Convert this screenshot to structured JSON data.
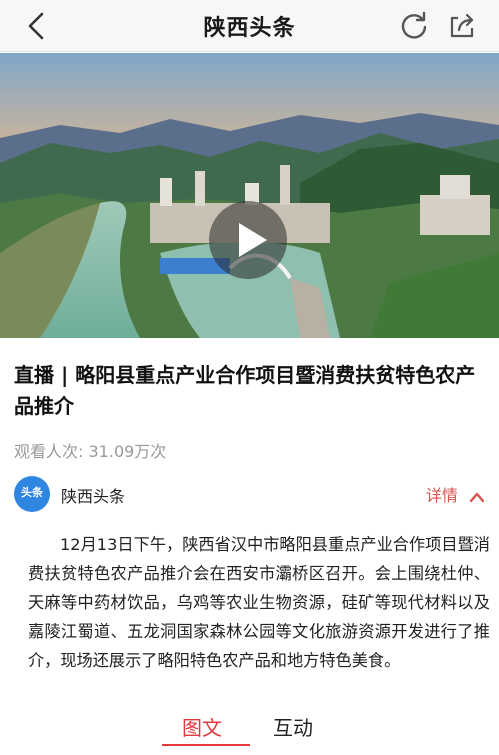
{
  "header": {
    "title": "陕西头条",
    "back_icon": "chevron-left-icon",
    "refresh_icon": "refresh-icon",
    "share_icon": "share-icon"
  },
  "video": {
    "play_icon": "play-icon"
  },
  "article": {
    "headline": "直播 | 略阳县重点产业合作项目暨消费扶贫特色农产品推介",
    "views_label": "观看人次:",
    "views_value": "31.09万次",
    "source_name": "陕西头条",
    "avatar_text": "头条",
    "detail_label": "详情",
    "body": "12月13日下午，陕西省汉中市略阳县重点产业合作项目暨消费扶贫特色农产品推介会在西安市灞桥区召开。会上围绕杜仲、天麻等中药材饮品，乌鸡等农业生物资源，硅矿等现代材料以及嘉陵江蜀道、五龙洞国家森林公园等文化旅游资源开发进行了推介，现场还展示了略阳特色农产品和地方特色美食。"
  },
  "tabs": [
    {
      "label": "图文",
      "active": true
    },
    {
      "label": "互动",
      "active": false
    }
  ],
  "colors": {
    "accent": "#e4393c",
    "avatar_bg": "#2f86e0",
    "muted_text": "#999999"
  }
}
